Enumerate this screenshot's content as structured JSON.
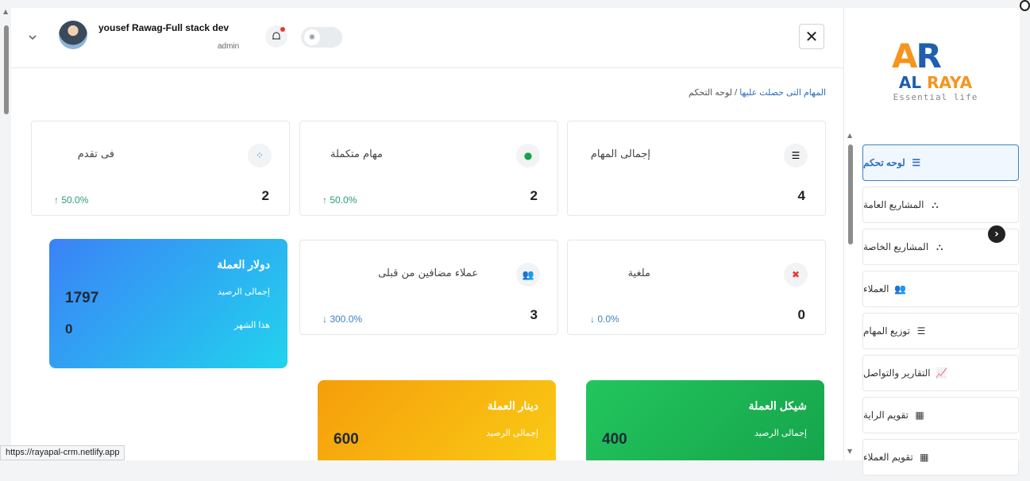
{
  "user": {
    "name": "yousef Rawag-Full stack dev",
    "role": "admin"
  },
  "breadcrumb": {
    "root": "لوحه التحكم",
    "sep": "/",
    "current": "المهام التى حصلت عليها"
  },
  "close_label": "✕",
  "stats": [
    {
      "label": "إجمالى المهام",
      "value": "4",
      "change": "",
      "icon": "list-check-icon"
    },
    {
      "label": "مهام متكملة",
      "value": "2",
      "change": "↑ 50.0%",
      "icon": "check-circle-icon"
    },
    {
      "label": "فى تقدم",
      "value": "2",
      "change": "↑ 50.0%",
      "icon": "spinner-icon"
    },
    {
      "label": "ملغية",
      "value": "0",
      "change": "↓ 0.0%",
      "icon": "cancel-circle-icon"
    },
    {
      "label": "عملاء مضافين من قبلى",
      "value": "3",
      "change": "↓ 300.0%",
      "icon": "users-icon"
    }
  ],
  "balances": [
    {
      "title": "دولار العملة",
      "line1": "إجمالى الرصيد",
      "value1": "1797",
      "line2": "هذا الشهر",
      "value2": "0",
      "color_from": "#3b82f6",
      "color_to": "#22d3ee"
    },
    {
      "title": "شيكل العملة",
      "line1": "إجمالى الرصيد",
      "value1": "400",
      "color_from": "#22c55e",
      "color_to": "#16a34a"
    },
    {
      "title": "دينار العملة",
      "line1": "إجمالى الرصيد",
      "value1": "600",
      "color_from": "#f59e0b",
      "color_to": "#facc15"
    }
  ],
  "logo": {
    "mark_a": "A",
    "mark_r": "R",
    "name_a": "AL ",
    "name_b": "RAYA",
    "tagline": "Essential life"
  },
  "nav": [
    {
      "label": "لوحه تحكم",
      "icon": "list-icon",
      "glyph": "☰",
      "active": true
    },
    {
      "label": "المشاريع العامة",
      "icon": "sitemap-icon",
      "glyph": "⛬"
    },
    {
      "label": "المشاريع الخاصة",
      "icon": "sitemap-icon",
      "glyph": "⛬"
    },
    {
      "label": "العملاء",
      "icon": "users-icon",
      "glyph": "👥"
    },
    {
      "label": "توزيع المهام",
      "icon": "list-check-icon",
      "glyph": "☰"
    },
    {
      "label": "التقارير والتواصل",
      "icon": "chart-line-icon",
      "glyph": "📈"
    },
    {
      "label": "تقويم الراية",
      "icon": "calendar-icon",
      "glyph": "▦"
    },
    {
      "label": "تقويم العملاء",
      "icon": "calendar-icon",
      "glyph": "▦"
    }
  ],
  "status_url": "https://rayapal-crm.netlify.app",
  "colors": {
    "accent": "#2c6fbb",
    "positive": "#2e9c72",
    "negative": "#3b82c4"
  }
}
